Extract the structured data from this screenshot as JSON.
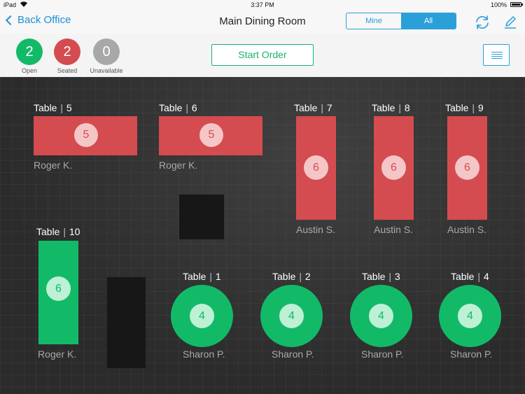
{
  "status_bar": {
    "device": "iPad",
    "time": "3:37 PM",
    "battery": "100%"
  },
  "nav": {
    "back_label": "Back Office",
    "title": "Main Dining Room",
    "filter_options": [
      "Mine",
      "All"
    ],
    "filter_selected": "All"
  },
  "summary": {
    "open": {
      "count": "2",
      "label": "Open",
      "color": "#12ba68"
    },
    "seated": {
      "count": "2",
      "label": "Seated",
      "color": "#d44c4f"
    },
    "unavailable": {
      "count": "0",
      "label": "Unavailable",
      "color": "#a8a8a8"
    },
    "start_order_label": "Start Order"
  },
  "floor": {
    "tables": [
      {
        "word": "Table",
        "number": "5",
        "seats": "5",
        "server": "Roger K.",
        "status": "seated",
        "shape": "rect-wide"
      },
      {
        "word": "Table",
        "number": "6",
        "seats": "5",
        "server": "Roger K.",
        "status": "seated",
        "shape": "rect-wide"
      },
      {
        "word": "Table",
        "number": "7",
        "seats": "6",
        "server": "Austin S.",
        "status": "seated",
        "shape": "rect-tall"
      },
      {
        "word": "Table",
        "number": "8",
        "seats": "6",
        "server": "Austin S.",
        "status": "seated",
        "shape": "rect-tall"
      },
      {
        "word": "Table",
        "number": "9",
        "seats": "6",
        "server": "Austin S.",
        "status": "seated",
        "shape": "rect-tall"
      },
      {
        "word": "Table",
        "number": "10",
        "seats": "6",
        "server": "Roger K.",
        "status": "open",
        "shape": "rect-tall"
      },
      {
        "word": "Table",
        "number": "1",
        "seats": "4",
        "server": "Sharon P.",
        "status": "open",
        "shape": "round"
      },
      {
        "word": "Table",
        "number": "2",
        "seats": "4",
        "server": "Sharon P.",
        "status": "open",
        "shape": "round"
      },
      {
        "word": "Table",
        "number": "3",
        "seats": "4",
        "server": "Sharon P.",
        "status": "open",
        "shape": "round"
      },
      {
        "word": "Table",
        "number": "4",
        "seats": "4",
        "server": "Sharon P.",
        "status": "open",
        "shape": "round"
      }
    ]
  },
  "colors": {
    "accent": "#2a9fd8",
    "open": "#12ba68",
    "seated": "#d44c4f",
    "floor": "#2b2b2b"
  }
}
